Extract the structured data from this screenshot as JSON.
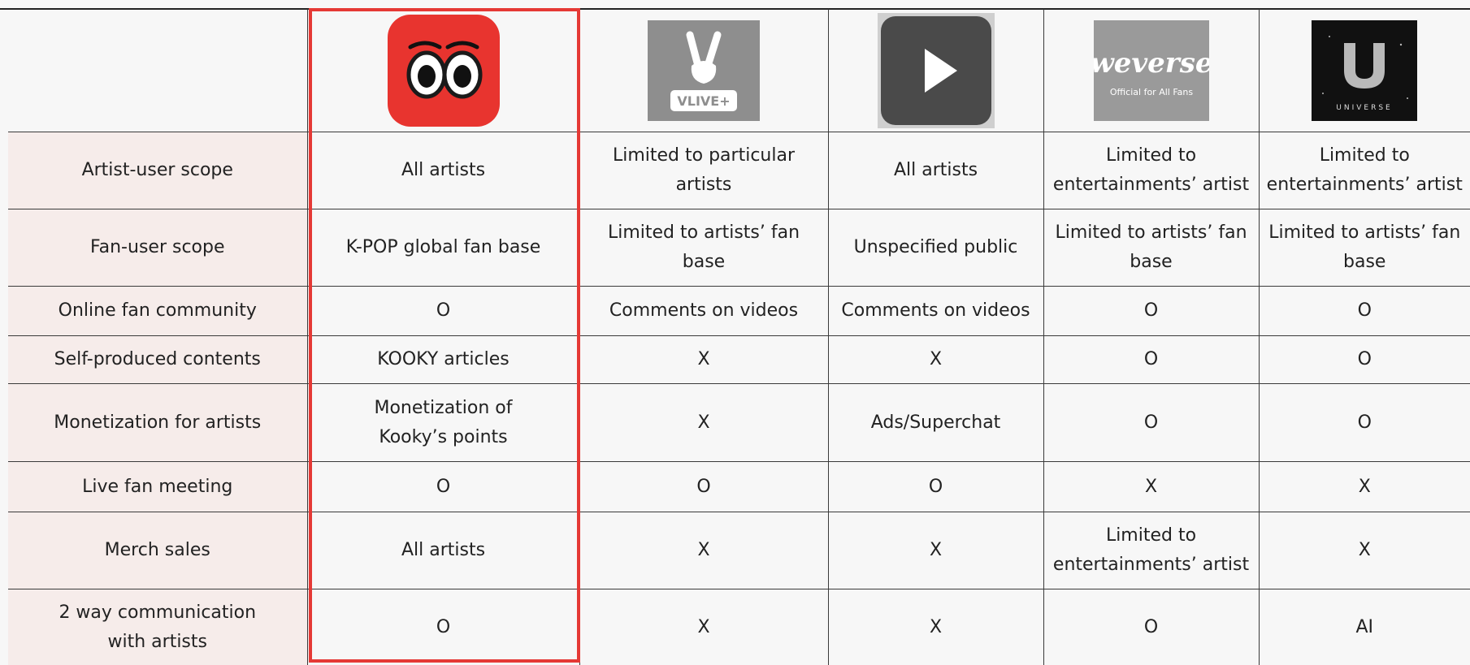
{
  "platforms": [
    {
      "name": "Kooky",
      "icon": "kooky-eyes-logo-icon",
      "color": "#e8342f"
    },
    {
      "name": "V LIVE",
      "icon": "vlive-peace-hand-logo-icon",
      "color": "#8e8e8e",
      "logo_text": "VLIVE+"
    },
    {
      "name": "YouTube",
      "icon": "youtube-play-logo-icon",
      "color": "#4a4a4a"
    },
    {
      "name": "Weverse",
      "icon": "weverse-wordmark-logo-icon",
      "color": "#9a9a9a",
      "logo_text": "weverse",
      "logo_subtext": "Official for All Fans"
    },
    {
      "name": "Universe",
      "icon": "universe-u-logo-icon",
      "color": "#111111",
      "logo_text": "UNIVERSE"
    }
  ],
  "highlight_color": "#e53935",
  "rows": [
    {
      "label": "Artist-user scope",
      "cells": [
        "All artists",
        "Limited to particular artists",
        "All artists",
        "Limited to entertainments’ artist",
        "Limited to entertainments’ artist"
      ]
    },
    {
      "label": "Fan-user scope",
      "cells": [
        "K-POP global fan base",
        "Limited to artists’ fan base",
        "Unspecified public",
        "Limited to artists’ fan base",
        "Limited to artists’ fan base"
      ]
    },
    {
      "label": "Online fan community",
      "cells": [
        "O",
        "Comments on videos",
        "Comments on videos",
        "O",
        "O"
      ]
    },
    {
      "label": "Self-produced contents",
      "cells": [
        "KOOKY articles",
        "X",
        "X",
        "O",
        "O"
      ]
    },
    {
      "label": "Monetization for artists",
      "cells": [
        "Monetization of Kooky’s points",
        "X",
        "Ads/Superchat",
        "O",
        "O"
      ]
    },
    {
      "label": "Live fan meeting",
      "cells": [
        "O",
        "O",
        "O",
        "X",
        "X"
      ]
    },
    {
      "label": "Merch sales",
      "cells": [
        "All artists",
        "X",
        "X",
        "Limited to entertainments’ artist",
        "X"
      ]
    },
    {
      "label": "2 way communication with artists",
      "cells": [
        "O",
        "X",
        "X",
        "O",
        "AI"
      ]
    }
  ]
}
